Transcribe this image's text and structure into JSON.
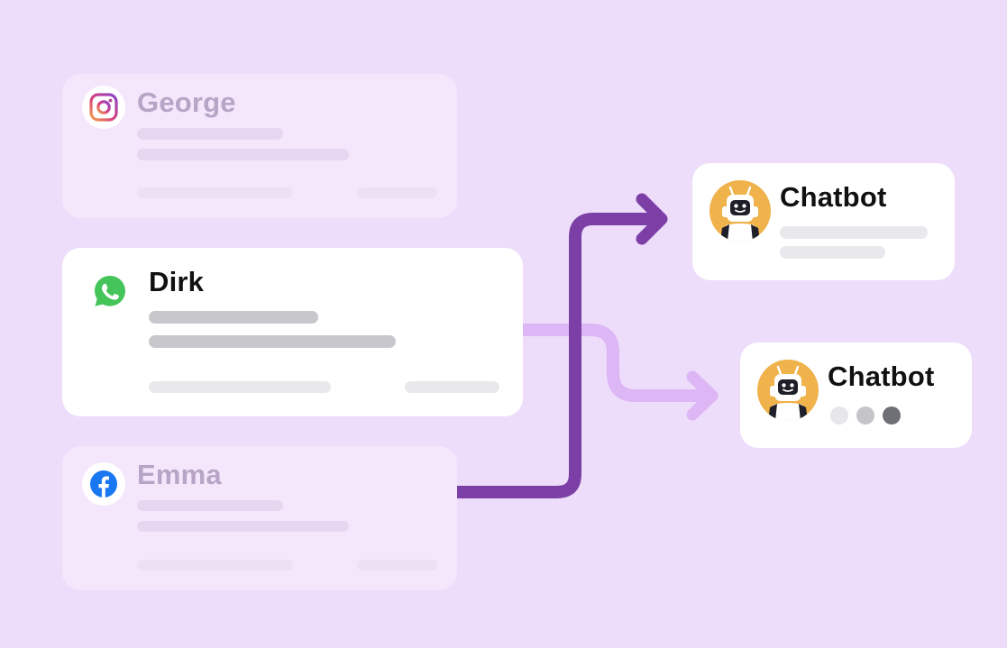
{
  "contacts": [
    {
      "name": "George",
      "channel": "instagram-icon"
    },
    {
      "name": "Dirk",
      "channel": "whatsapp-icon"
    },
    {
      "name": "Emma",
      "channel": "facebook-icon"
    }
  ],
  "bots": [
    {
      "name": "Chatbot"
    },
    {
      "name": "Chatbot"
    }
  ],
  "colors": {
    "background": "#eddcfa",
    "dark_flow": "#7b3fa6",
    "light_flow": "#ddb6f5",
    "bot_avatar": "#f0b24a"
  }
}
